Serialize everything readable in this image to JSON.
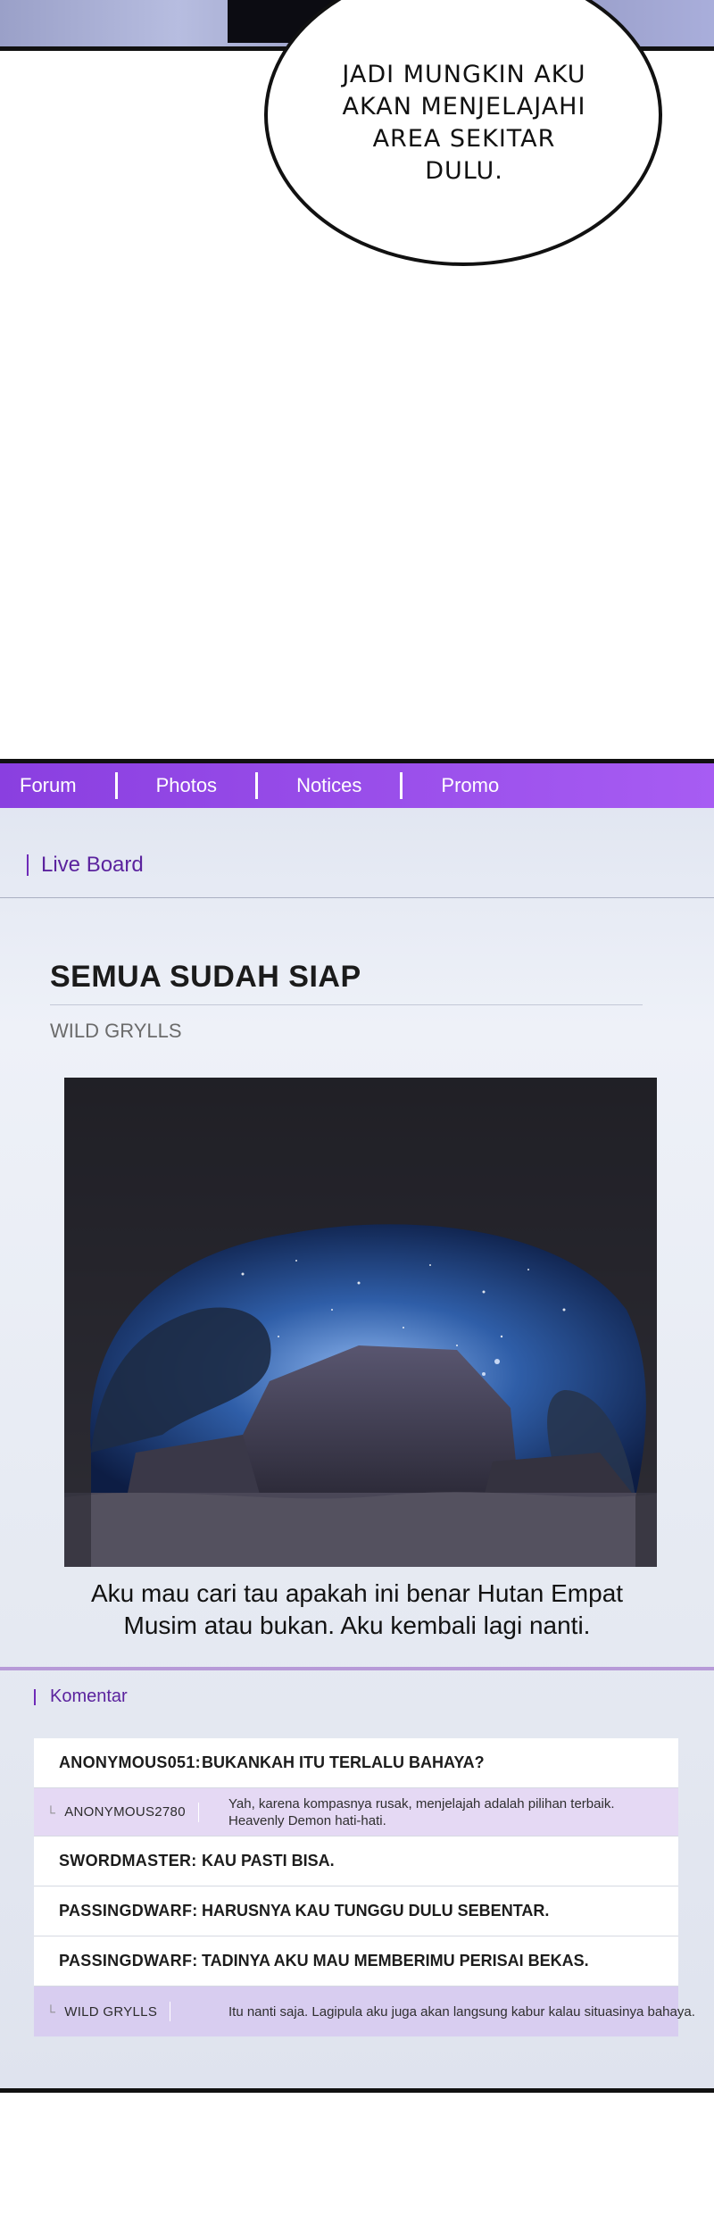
{
  "speech_bubble": {
    "text": "JADI MUNGKIN AKU\nAKAN MENJELAJAHI\nAREA SEKITAR\nDULU."
  },
  "forum": {
    "nav": [
      {
        "label": "Forum"
      },
      {
        "label": "Photos"
      },
      {
        "label": "Notices"
      },
      {
        "label": "Promo"
      }
    ],
    "board_label": "Live Board",
    "post": {
      "title": "SEMUA SUDAH SIAP",
      "author": "WILD GRYLLS",
      "caption": "Aku mau cari tau apakah ini benar Hutan Empat Musim atau bukan. Aku kembali lagi nanti."
    },
    "comments_label": "Komentar",
    "comments": [
      {
        "type": "main",
        "user": "ANONYMOUS051:",
        "text": "BUKANKAH ITU TERLALU BAHAYA?"
      },
      {
        "type": "reply",
        "user": "ANONYMOUS2780",
        "text": "Yah, karena kompasnya rusak, menjelajah adalah pilihan terbaik. Heavenly Demon hati-hati."
      },
      {
        "type": "main",
        "user": "SWORDMASTER:",
        "text": "KAU PASTI BISA."
      },
      {
        "type": "main",
        "user": "PASSINGDWARF:",
        "text": "HARUSNYA KAU TUNGGU DULU SEBENTAR."
      },
      {
        "type": "main",
        "user": "PASSINGDWARF:",
        "text": "TADINYA AKU MAU MEMBERIMU PERISAI BEKAS."
      },
      {
        "type": "reply",
        "user": "WILD GRYLLS",
        "text": "Itu nanti saja. Lagipula aku juga akan langsung kabur kalau situasinya bahaya."
      }
    ]
  }
}
